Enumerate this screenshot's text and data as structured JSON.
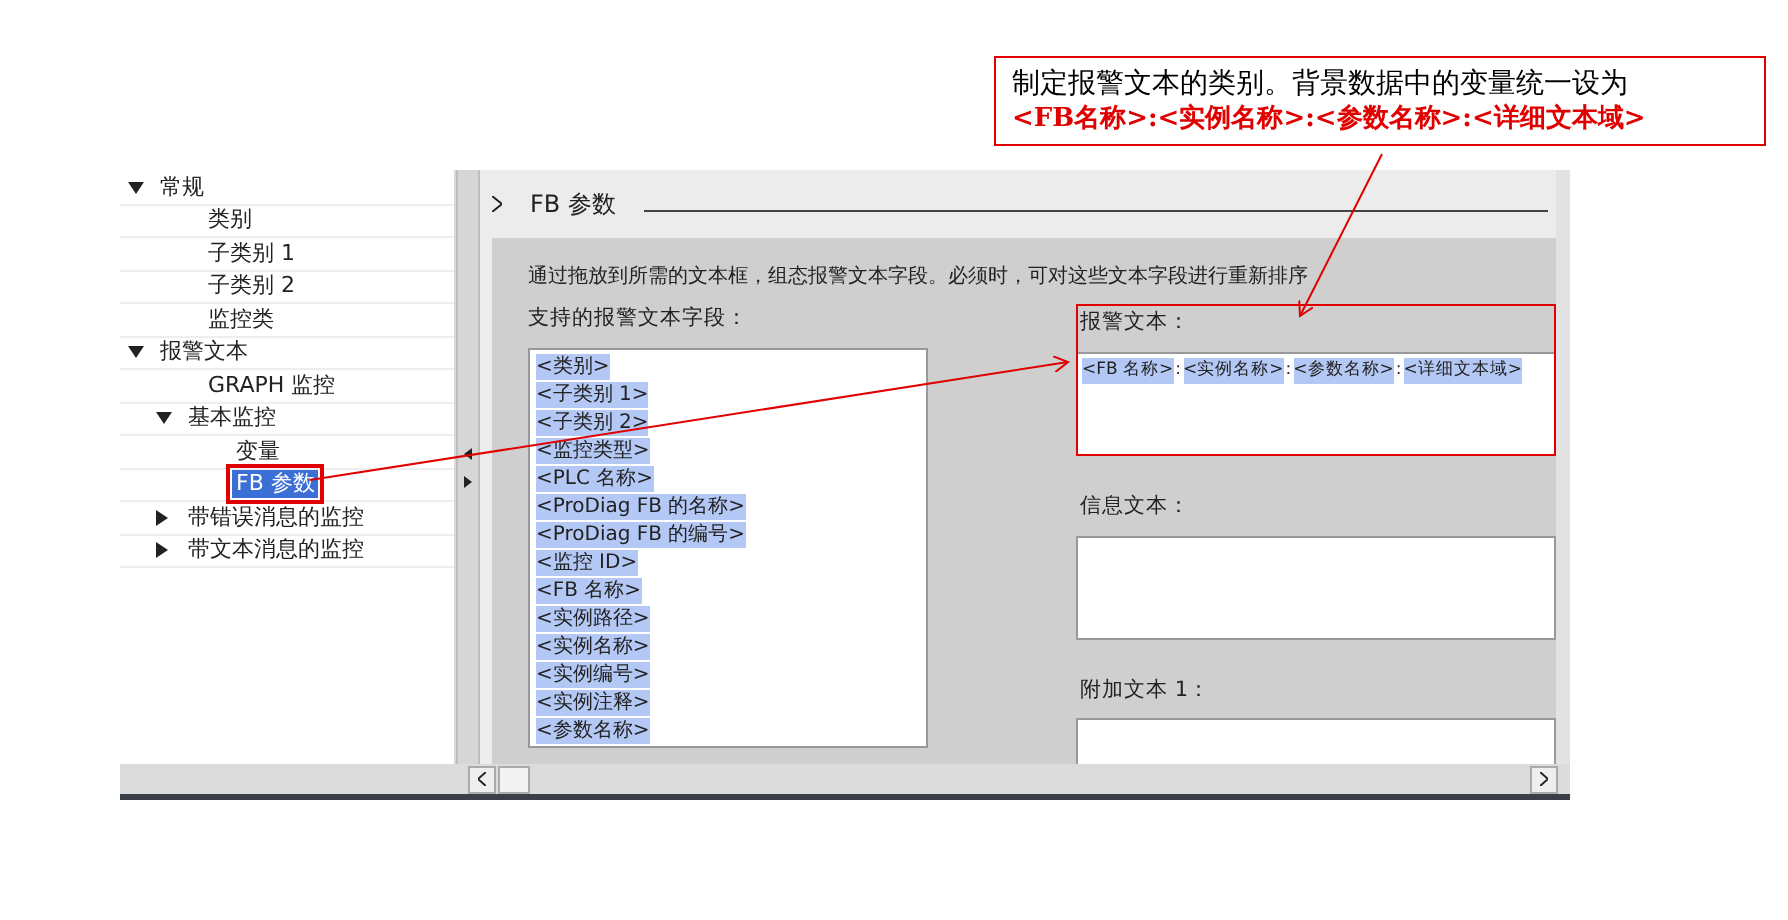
{
  "tree": [
    {
      "label": "常规",
      "expanded": true,
      "children": [
        {
          "label": "类别",
          "selected": false
        },
        {
          "label": "子类别 1",
          "selected": false
        },
        {
          "label": "子类别 2",
          "selected": false
        },
        {
          "label": "监控类",
          "selected": false
        }
      ]
    },
    {
      "label": "报警文本",
      "expanded": true,
      "children": [
        {
          "label": "GRAPH 监控",
          "selected": false
        },
        {
          "label": "基本监控",
          "expanded": true,
          "children": [
            {
              "label": "变量",
              "selected": false
            },
            {
              "label": "FB 参数",
              "selected": true
            }
          ]
        },
        {
          "label": "带错误消息的监控",
          "expanded": false
        },
        {
          "label": "带文本消息的监控",
          "expanded": false
        }
      ]
    }
  ],
  "section": {
    "title": "FB 参数",
    "hint": "通过拖放到所需的文本框，组态报警文本字段。必须时，可对这些文本字段进行重新排序",
    "supported_label": "支持的报警文本字段：",
    "supported_fields": [
      "<类别>",
      "<子类别 1>",
      "<子类别 2>",
      "<监控类型>",
      "<PLC 名称>",
      "<ProDiag FB 的名称>",
      "<ProDiag FB 的编号>",
      "<监控 ID>",
      "<FB 名称>",
      "<实例路径>",
      "<实例名称>",
      "<实例编号>",
      "<实例注释>",
      "<参数名称>"
    ],
    "text_boxes": [
      {
        "label": "报警文本：",
        "tokens": [
          {
            "kind": "field",
            "text": "<FB 名称>"
          },
          {
            "kind": "sep",
            "text": ":"
          },
          {
            "kind": "field",
            "text": "<实例名称>"
          },
          {
            "kind": "sep",
            "text": ":"
          },
          {
            "kind": "field",
            "text": "<参数名称>"
          },
          {
            "kind": "sep",
            "text": ":"
          },
          {
            "kind": "field",
            "text": "<详细文本域>"
          }
        ]
      },
      {
        "label": "信息文本："
      },
      {
        "label": "附加文本 1："
      }
    ]
  },
  "annotation": {
    "line_1": "制定报警文本的类别。背景数据中的变量统一设为",
    "line_2": "<FB名称>:<实例名称>:<参数名称>:<详细文本域>"
  }
}
